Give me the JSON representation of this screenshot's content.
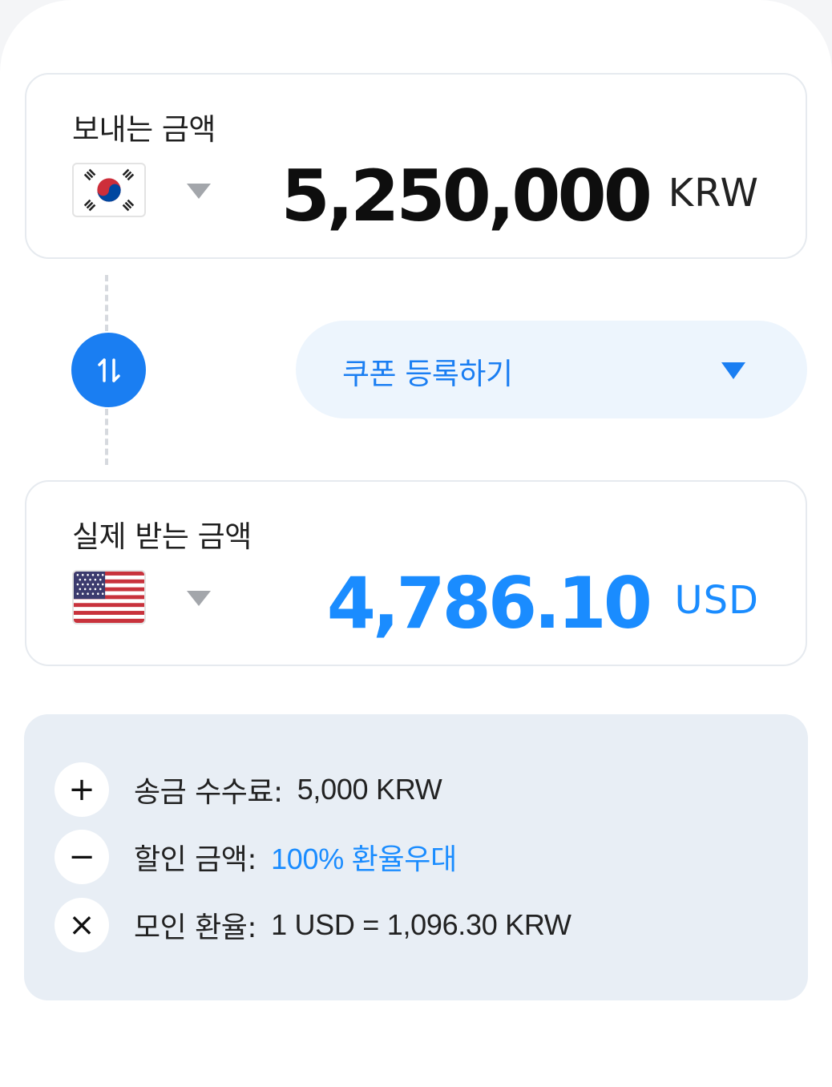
{
  "send": {
    "label": "보내는 금액",
    "amount": "5,250,000",
    "currency": "KRW",
    "flag": "south-korea-flag"
  },
  "swap": {
    "icon": "swap-arrows-icon"
  },
  "coupon": {
    "label": "쿠폰 등록하기"
  },
  "receive": {
    "label": "실제 받는 금액",
    "amount": "4,786.10",
    "currency": "USD",
    "flag": "united-states-flag"
  },
  "summary": {
    "rows": [
      {
        "operator": "+",
        "label": "송금 수수료:",
        "value": "5,000 KRW"
      },
      {
        "operator": "−",
        "label": "할인 금액:",
        "value": "100% 환율우대"
      },
      {
        "operator": "×",
        "label": "모인 환율:",
        "value": "1 USD = 1,096.30 KRW"
      }
    ]
  },
  "colors": {
    "accent": "#1a7ef2",
    "amount_blue": "#1a8cff",
    "coupon_bg": "#edf5fd",
    "summary_bg": "#e8eef5"
  }
}
